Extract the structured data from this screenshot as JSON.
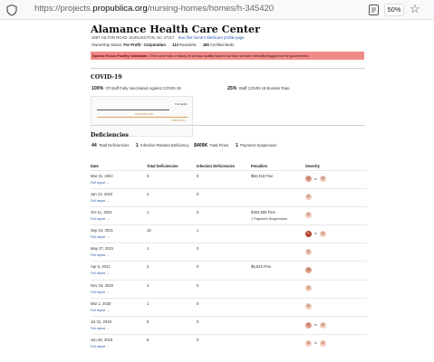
{
  "browser": {
    "url_prefix": "https://projects.",
    "url_domain": "propublica.org",
    "url_path": "/nursing-homes/homes/h-345420",
    "zoom": "50%"
  },
  "facility": {
    "name": "Alamance Health Care Center",
    "address": "1987 HILTON ROAD, BURLINGTON, NC 27217",
    "medicare_link": "See this home's Medicare profile page",
    "ownership_label": "Ownership Status:",
    "ownership_value": "For Profit - Corporation",
    "residents_num": "113",
    "residents_label": "Residents",
    "beds_num": "180",
    "beds_label": "Certified Beds",
    "alert_label": "Special Focus Facility Candidate:",
    "alert_text": "This home has a history of serious quality issues but has not been formally flagged by the government."
  },
  "covid": {
    "heading": "COVID-19",
    "vacc_value": "100%",
    "vacc_label": "Of Staff Fully Vaccinated Against COVID-19",
    "booster_value": "25%",
    "booster_label": "Staff COVID-19 Booster Rate",
    "chart_label_top": "This facility",
    "chart_label_mid": "NATIONAL AVG",
    "chart_label_state": "STATE AVG"
  },
  "deficiencies": {
    "heading": "Deficiencies",
    "total_num": "44",
    "total_label": "Total Deficiencies",
    "infection_num": "1",
    "infection_label": "Infection-Related Deficiency",
    "fines_num": "$409K",
    "fines_label": "Total Fines",
    "susp_num": "1",
    "susp_label": "Payment Suspension"
  },
  "table": {
    "headers": [
      "Date",
      "Total Deficiencies",
      "Infection Deficiencies",
      "Penalties",
      "Severity"
    ],
    "report_label": "Full report →",
    "to_label": "to",
    "rows": [
      {
        "date": "Mar 31, 2022",
        "total": "6",
        "infection": "0",
        "penalty": "$50,316 Fine",
        "penalty2": "",
        "sev_from": "H",
        "sev_to": "D"
      },
      {
        "date": "Jan 13, 2022",
        "total": "2",
        "infection": "0",
        "penalty": "",
        "penalty2": "",
        "sev_from": "",
        "sev_to": "D"
      },
      {
        "date": "Oct 11, 2021",
        "total": "1",
        "infection": "0",
        "penalty": "$352,606 Fine",
        "penalty2": "1 Payment Suspension",
        "sev_from": "",
        "sev_to": "D"
      },
      {
        "date": "Sep 24, 2021",
        "total": "16",
        "infection": "1",
        "penalty": "",
        "penalty2": "",
        "sev_from": "K",
        "sev_to": "D"
      },
      {
        "date": "May 27, 2021",
        "total": "1",
        "infection": "0",
        "penalty": "",
        "penalty2": "",
        "sev_from": "",
        "sev_to": "E"
      },
      {
        "date": "Apr 6, 2021",
        "total": "2",
        "infection": "0",
        "penalty": "$6,815 Fine",
        "penalty2": "",
        "sev_from": "",
        "sev_to": "G"
      },
      {
        "date": "Nov 18, 2020",
        "total": "3",
        "infection": "0",
        "penalty": "",
        "penalty2": "",
        "sev_from": "",
        "sev_to": "D"
      },
      {
        "date": "Mar 1, 2020",
        "total": "1",
        "infection": "0",
        "penalty": "",
        "penalty2": "",
        "sev_from": "",
        "sev_to": "D"
      },
      {
        "date": "Jul 31, 2019",
        "total": "6",
        "infection": "0",
        "penalty": "",
        "penalty2": "",
        "sev_from": "G",
        "sev_to": "D"
      },
      {
        "date": "Jun 26, 2019",
        "total": "6",
        "infection": "0",
        "penalty": "",
        "penalty2": "",
        "sev_from": "D",
        "sev_to": "C"
      }
    ]
  },
  "colors": {
    "sev_light": "#f2c9b8",
    "sev_mid": "#e3a08a",
    "sev_dark": "#b5412a",
    "alert_bg": "#f08c87",
    "link": "#1a56a6"
  }
}
